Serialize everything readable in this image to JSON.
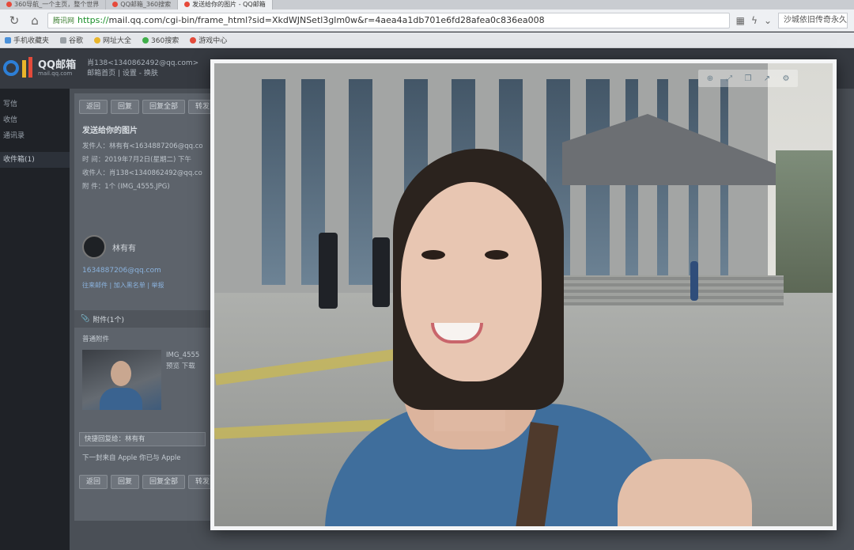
{
  "browser": {
    "tabs": [
      {
        "label": "360导航_一个主页，整个世界",
        "active": false
      },
      {
        "label": "QQ邮箱_360搜索",
        "active": false
      },
      {
        "label": "发送给你的图片 - QQ邮箱",
        "active": true
      }
    ],
    "site_tag": "腾讯网",
    "url_scheme": "https://",
    "url_rest": "mail.qq.com/cgi-bin/frame_html?sid=XkdWJNSetl3glm0w&r=4aea4a1db701e6fd28afea0c836ea008",
    "search_placeholder": "沙城依旧传奇永久",
    "bookmarks": [
      "手机收藏夹",
      "谷歌",
      "网址大全",
      "360搜索",
      "游戏中心"
    ]
  },
  "mail": {
    "logo_title": "QQ邮箱",
    "logo_sub": "mail.qq.com",
    "account_line1": "肖138<1340862492@qq.com>",
    "account_line2": "邮箱首页 | 设置 - 换肤",
    "sidebar": [
      "写信",
      "收信",
      "通讯录",
      "收件箱(1)"
    ],
    "buttons": [
      "返回",
      "回复",
      "回复全部",
      "转发"
    ],
    "subject": "发送给你的图片",
    "meta": [
      "发件人：林有有<1634887206@qq.com>",
      "时 间：2019年7月2日(星期二) 下午",
      "收件人：肖138<1340862492@qq.com>",
      "附 件：1个 (IMG_4555.JPG)"
    ],
    "sender_name": "林有有",
    "sender_email": "1634887206@qq.com",
    "sender_links": "往来邮件 | 加入黑名单 | 举报",
    "attachment_header": "附件(1个)",
    "attachment_sub": "普通附件",
    "attachment_name": "IMG_4555",
    "attachment_actions": "预览  下载",
    "reply_placeholder": "快捷回复给：林有有",
    "promo": "下一封来自 Apple  你已与 Apple",
    "bottom_buttons": [
      "返回",
      "回复",
      "回复全部",
      "转发"
    ]
  },
  "viewer": {
    "toolbar_icons": [
      "zoom-in-icon",
      "fullscreen-icon",
      "copy-icon",
      "open-external-icon",
      "settings-icon"
    ]
  }
}
